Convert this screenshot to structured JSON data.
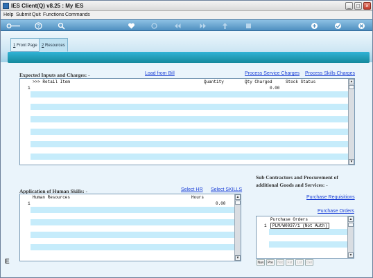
{
  "window": {
    "title": "IES Client(Q) v8.25 : My IES",
    "minimize_glyph": "_",
    "maximize_glyph": "□",
    "close_glyph": "×"
  },
  "menu": [
    "Help",
    "Submit",
    "Quit",
    "Functions",
    "Commands"
  ],
  "toolbar": {
    "icons": [
      "key-icon",
      "help-icon",
      "search-icon",
      "heart-icon",
      "refresh-icon",
      "rewind-icon",
      "fast-forward-icon",
      "upload-icon",
      "stop-icon",
      "add-icon",
      "check-icon",
      "close-icon"
    ]
  },
  "tabs": [
    {
      "num": "1",
      "label": "Front Page"
    },
    {
      "num": "2",
      "label": "Resources"
    }
  ],
  "inputs_section": {
    "title": "Expected Inputs and Charges: -",
    "link_load_bill": "Load from Bill",
    "link_service": "Process Service Charges",
    "link_skills": "Process Skills Charges",
    "columns": [
      ">>> Retail Item",
      "Quantity",
      "Qty Charged",
      "Stock Status"
    ],
    "rows": [
      {
        "num": "1",
        "retail_item": "",
        "quantity": "",
        "qty_charged": "0.00",
        "stock_status": ""
      }
    ]
  },
  "skills_section": {
    "title": "Application of Human Skills: -",
    "link_select_hr": "Select HR",
    "link_select_skills": "Select SKILLS",
    "columns": [
      "Human Resources",
      "Hours"
    ],
    "rows": [
      {
        "num": "1",
        "human_resources": "",
        "hours": "0.00"
      }
    ]
  },
  "subcontract_section": {
    "title_line1": "Sub Contractors and Procurement of",
    "title_line2": "additional Goods and Services: -",
    "link_requisitions": "Purchase Requisitions",
    "link_orders": "Purchase Orders",
    "columns": [
      "Purchase Orders"
    ],
    "rows": [
      {
        "num": "1",
        "purchase_order": "PLM/W0037/1 (Not Auth)"
      }
    ],
    "nav_buttons": [
      "Nav",
      "Pre",
      "Nxt",
      "Fst",
      "Lst",
      "Del"
    ]
  },
  "left_fragment": "E",
  "colors": {
    "toolbar": "#4f8fc0",
    "band": "#15899c",
    "row_blue": "#c6ecfb",
    "link": "#1a3fd6"
  }
}
